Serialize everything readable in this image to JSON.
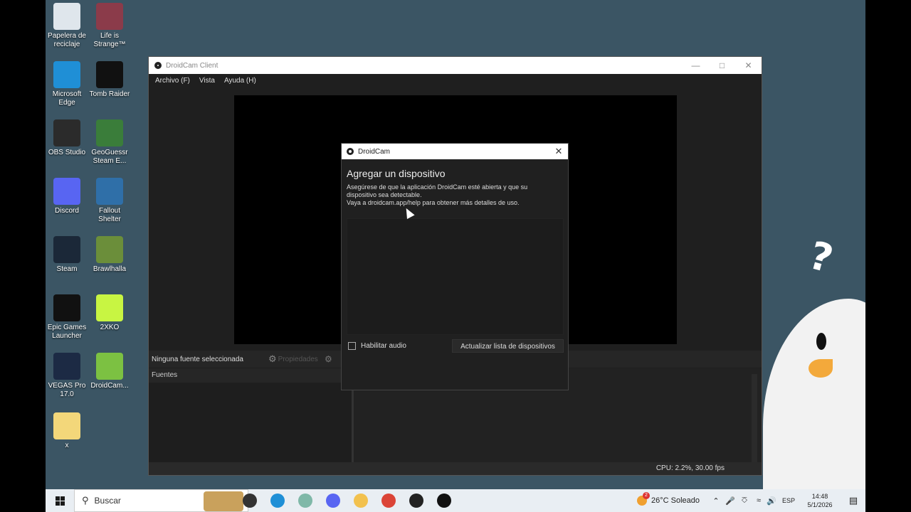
{
  "desktop_icons": [
    {
      "label": "Papelera de reciclaje",
      "icon": "recycle-bin-icon",
      "color": "#dfe6ec"
    },
    {
      "label": "Life is Strange™",
      "icon": "life-is-strange-icon",
      "color": "#8b3b4a"
    },
    {
      "label": "Microsoft Edge",
      "icon": "edge-icon",
      "color": "#1f8fd6"
    },
    {
      "label": "Tomb Raider",
      "icon": "tomb-raider-icon",
      "color": "#111111"
    },
    {
      "label": "OBS Studio",
      "icon": "obs-icon",
      "color": "#2b2b2b"
    },
    {
      "label": "GeoGuessr Steam E...",
      "icon": "geoguessr-icon",
      "color": "#3a7d3a"
    },
    {
      "label": "Discord",
      "icon": "discord-icon",
      "color": "#5865f2"
    },
    {
      "label": "Fallout Shelter",
      "icon": "fallout-shelter-icon",
      "color": "#2f6fa8"
    },
    {
      "label": "Steam",
      "icon": "steam-icon",
      "color": "#1b2838"
    },
    {
      "label": "Brawlhalla",
      "icon": "brawlhalla-icon",
      "color": "#6b8e3a"
    },
    {
      "label": "Epic Games Launcher",
      "icon": "epic-games-icon",
      "color": "#111111"
    },
    {
      "label": "2XKO",
      "icon": "2xko-icon",
      "color": "#c8f542"
    },
    {
      "label": "VEGAS Pro 17.0",
      "icon": "vegas-pro-icon",
      "color": "#1c2a44"
    },
    {
      "label": "DroidCam...",
      "icon": "droidcam-icon",
      "color": "#7cc142"
    },
    {
      "label": "x",
      "icon": "folder-icon",
      "color": "#f3d77a"
    }
  ],
  "main_window": {
    "title": "DroidCam Client",
    "menu": [
      "Archivo (F)",
      "Vista",
      "Ayuda (H)"
    ],
    "no_source": "Ninguna fuente seleccionada",
    "properties": "Propiedades",
    "sources_title": "Fuentes",
    "status": "CPU: 2.2%, 30.00 fps"
  },
  "dialog": {
    "title": "DroidCam",
    "heading": "Agregar un dispositivo",
    "line1": "Asegúrese de que la aplicación DroidCam esté abierta y que su",
    "line2": "dispositivo sea detectable.",
    "line3": "Vaya a droidcam.app/help para obtener más detalles de uso.",
    "audio_label": "Habilitar audio",
    "audio_checked": false,
    "refresh_button": "Actualizar lista de dispositivos"
  },
  "taskbar": {
    "search_placeholder": "Buscar",
    "weather": "26°C  Soleado",
    "weather_badge": "2",
    "language": "ESP",
    "time": "14:48",
    "date": "5/1/2026",
    "apps": [
      {
        "name": "task-view-icon",
        "color": "#333333"
      },
      {
        "name": "edge-icon",
        "color": "#1f8fd6"
      },
      {
        "name": "tablet-app-icon",
        "color": "#7fb8a8"
      },
      {
        "name": "discord-icon",
        "color": "#5865f2"
      },
      {
        "name": "file-explorer-icon",
        "color": "#f2c14e"
      },
      {
        "name": "chrome-icon",
        "color": "#db4437"
      },
      {
        "name": "obs-icon",
        "color": "#222222"
      },
      {
        "name": "droidcam-icon",
        "color": "#111111"
      }
    ]
  }
}
